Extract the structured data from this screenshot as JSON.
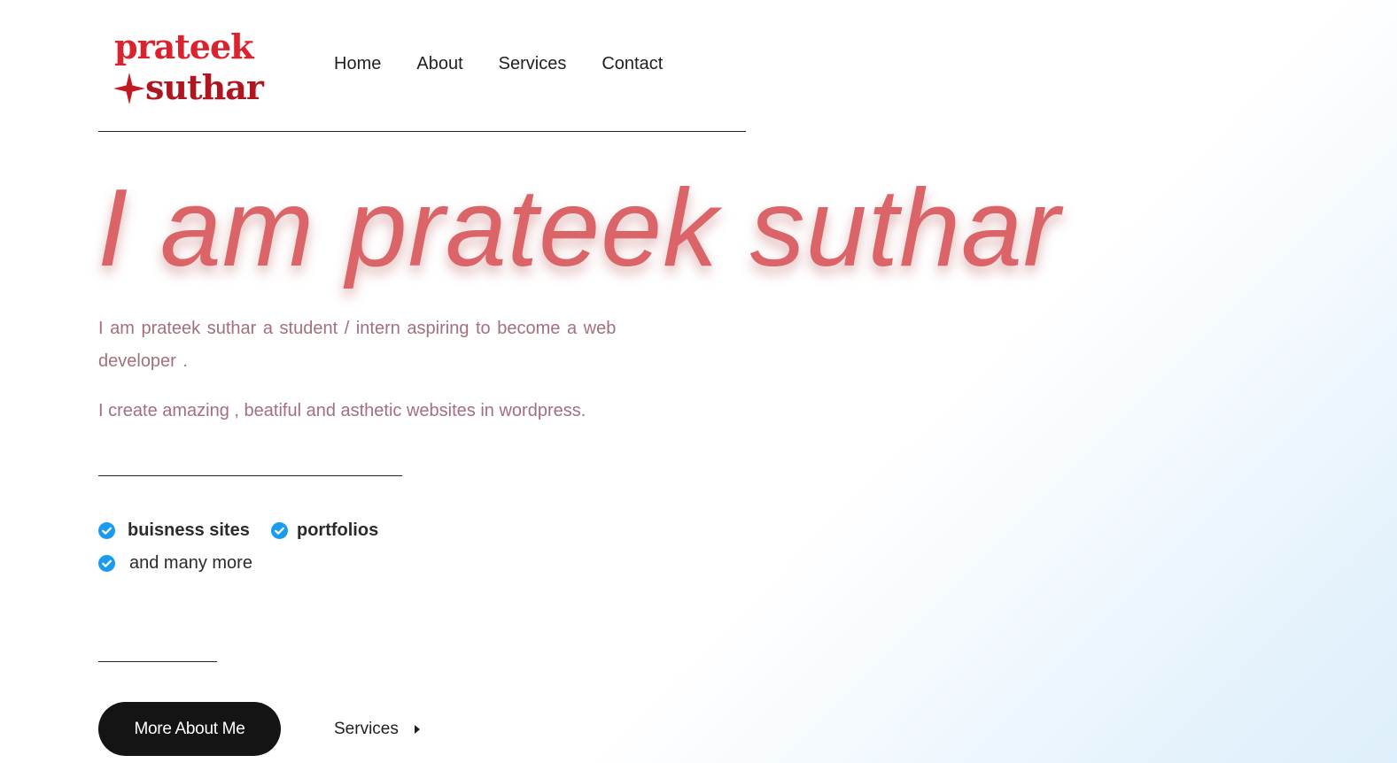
{
  "brand": {
    "logo_line1": "prateek",
    "logo_line2": "suthar",
    "logo_colors": [
      "#d9232e",
      "#b0161f"
    ]
  },
  "nav": {
    "items": [
      {
        "label": "Home"
      },
      {
        "label": "About"
      },
      {
        "label": "Services"
      },
      {
        "label": "Contact"
      }
    ]
  },
  "hero": {
    "title": "I am prateek suthar",
    "title_color": "#db6468",
    "intro": "I am prateek suthar a student / intern aspiring to become   a   web developer  .",
    "intro2": "I create amazing , beatiful and  asthetic websites in wordpress.",
    "text_color": "#a3707a"
  },
  "features": {
    "items": [
      {
        "label": "buisness sites",
        "icon": "check-circle-icon",
        "bold": true
      },
      {
        "label": "portfolios",
        "icon": "check-circle-icon",
        "bold": true
      },
      {
        "label": "and many more",
        "icon": "check-circle-icon",
        "bold": false
      }
    ],
    "icon_color": "#1a9bf0"
  },
  "cta": {
    "primary_label": "More About Me",
    "secondary_label": "Services",
    "secondary_icon": "caret-right-icon"
  },
  "background": {
    "base": "#ffffff",
    "accent": "#dfeffb"
  }
}
